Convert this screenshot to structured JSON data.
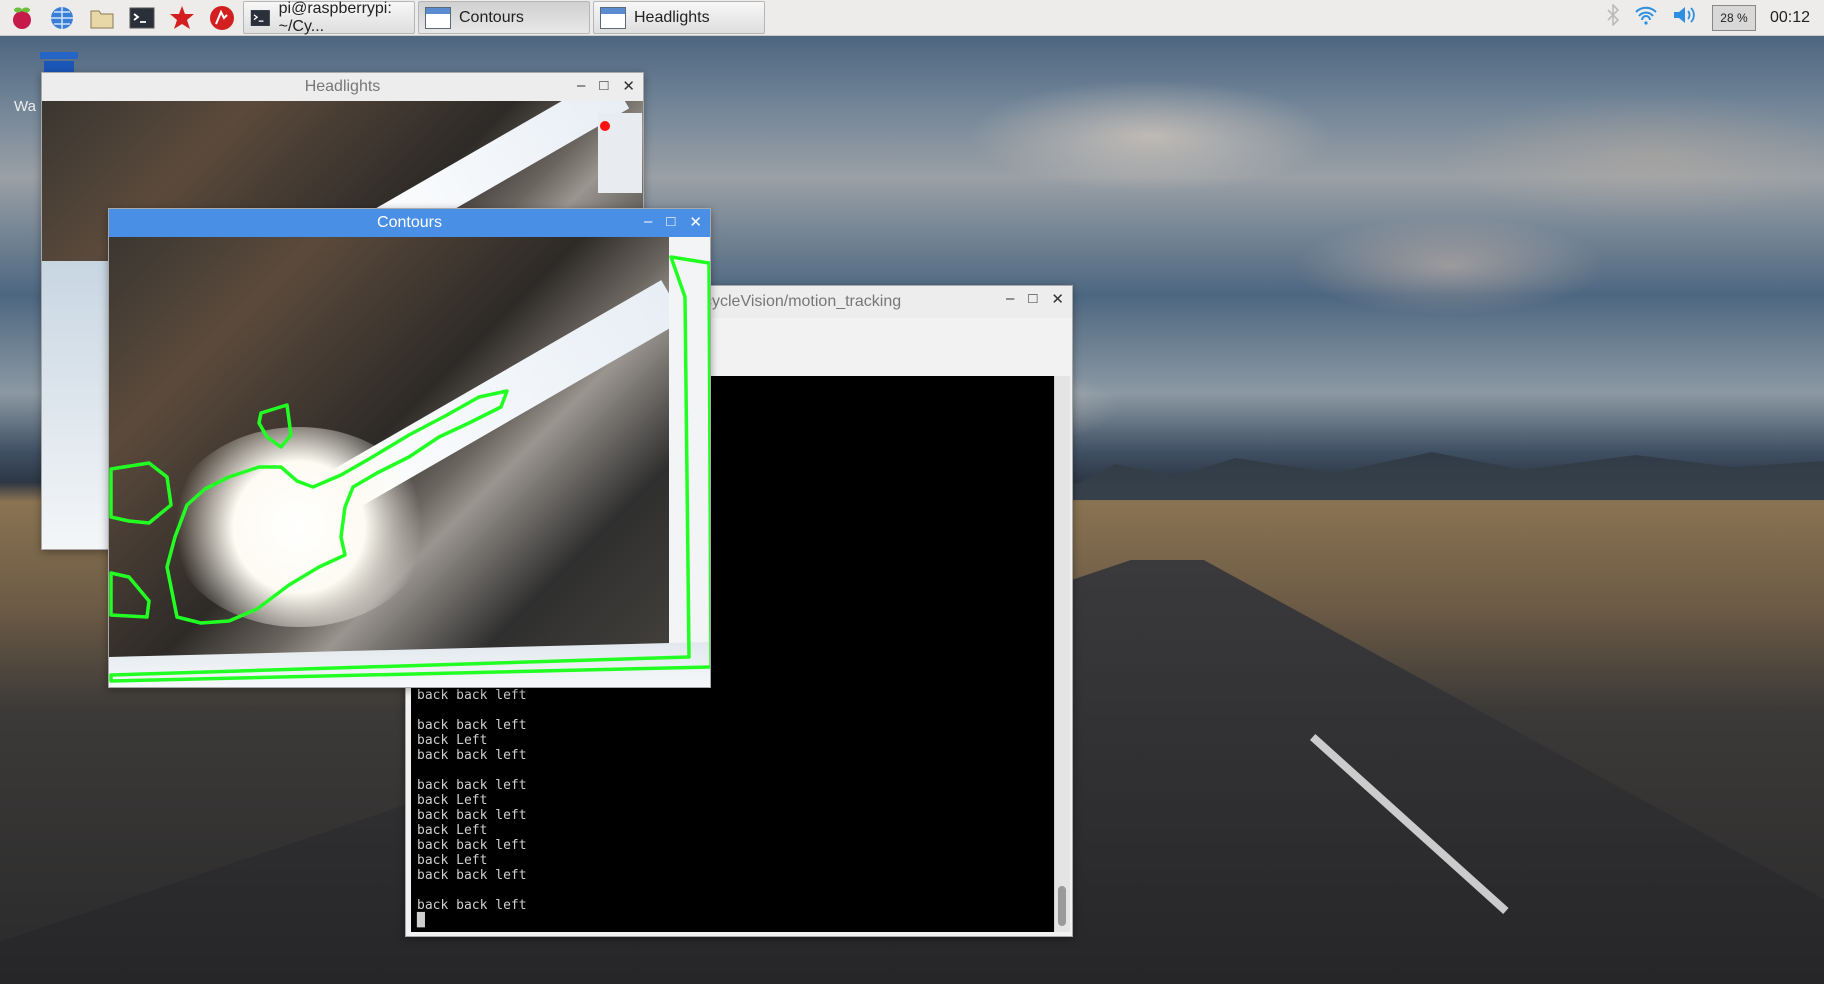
{
  "taskbar": {
    "launchers": [
      "raspberry-menu-icon",
      "web-browser-icon",
      "file-manager-icon",
      "terminal-icon",
      "mathematica-icon",
      "wolfram-icon"
    ],
    "tasks": [
      {
        "label": "pi@raspberrypi: ~/Cy..."
      },
      {
        "label": "Contours"
      },
      {
        "label": "Headlights"
      }
    ],
    "cpu": "28 %",
    "clock": "00:12"
  },
  "desktop": {
    "trash_label": "Wa"
  },
  "windows": {
    "headlights": {
      "title": "Headlights"
    },
    "contours": {
      "title": "Contours"
    },
    "terminal": {
      "title": "pi@raspberrypi: ~/CycleVision/motion_tracking",
      "title_visible": "cycleVision/motion_tracking",
      "lines": [
        "back back left",
        "",
        "back back left",
        "back Left",
        "back back left",
        "",
        "back back left",
        "back Left",
        "back back left",
        "back Left",
        "back back left",
        "back Left",
        "back back left",
        "",
        "back back left",
        "█"
      ]
    }
  },
  "controls": {
    "minimize": "–",
    "maximize": "□",
    "close": "✕"
  },
  "colors": {
    "accent": "#4a8fe6",
    "contour": "#22ff22"
  }
}
